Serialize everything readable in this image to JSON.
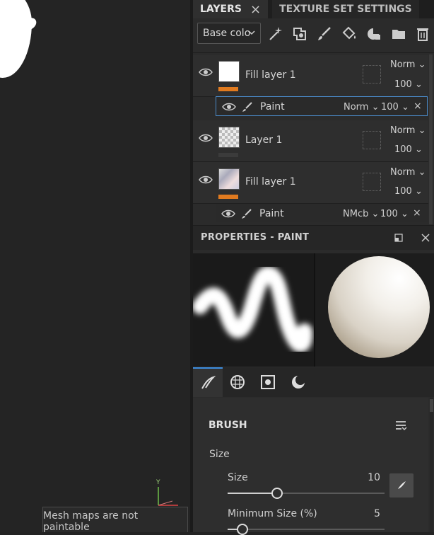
{
  "viewport": {
    "tooltip": "Mesh maps are not paintable",
    "gizmo_axis_y": "Y"
  },
  "tabs": {
    "layers": "LAYERS",
    "texture_set": "TEXTURE SET SETTINGS"
  },
  "toolbar": {
    "channel_select": "Base colo"
  },
  "layers": [
    {
      "name": "Fill layer 1",
      "blend": "Norm",
      "opacity": "100",
      "bar_color": "#e07a1f"
    },
    {
      "name": "Layer 1",
      "blend": "Norm",
      "opacity": "100",
      "bar_color": "#3b3b3b"
    },
    {
      "name": "Fill layer 1",
      "blend": "Norm",
      "opacity": "100",
      "bar_color": "#e07a1f"
    }
  ],
  "sublayers": [
    {
      "name": "Paint",
      "blend": "Norm",
      "opacity": "100"
    },
    {
      "name": "Paint",
      "blend": "NMcb",
      "opacity": "100"
    }
  ],
  "properties": {
    "title": "PROPERTIES - PAINT"
  },
  "brush": {
    "section_title": "BRUSH",
    "group_label": "Size",
    "size_label": "Size",
    "size_value": "10",
    "size_fraction": 0.31,
    "min_size_label": "Minimum Size (%)",
    "min_size_value": "5",
    "min_size_fraction": 0.09
  },
  "colors": {
    "accent": "#3d8ee0",
    "orange": "#e07a1f"
  }
}
